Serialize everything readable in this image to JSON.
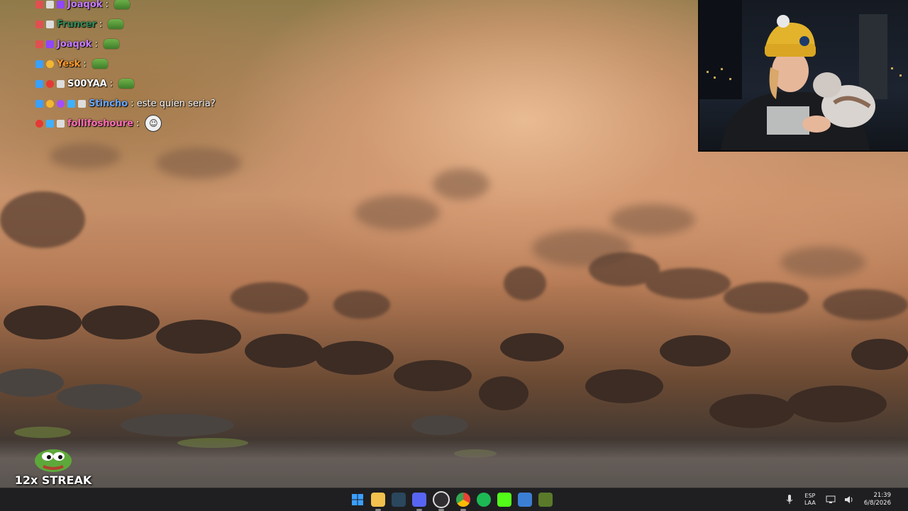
{
  "chat": {
    "messages": [
      {
        "user": "Joaqok",
        "text": ":",
        "user_color": "#c77dff",
        "emote": "pepe-emote",
        "badges": [
          "mod-icon",
          "sub-icon",
          "prime-icon"
        ]
      },
      {
        "user": "Fruncer",
        "text": ":",
        "user_color": "#2e8b57",
        "emote": "pepe-emote",
        "badges": [
          "mod-icon",
          "sub-icon"
        ]
      },
      {
        "user": "Joaqok",
        "text": ":",
        "user_color": "#c77dff",
        "emote": "pepe-emote",
        "badges": [
          "mod-icon",
          "prime-icon"
        ]
      },
      {
        "user": "Yesk",
        "text": ":",
        "user_color": "#ff9a2e",
        "emote": "pepe-emote",
        "badges": [
          "sword-icon",
          "coin-icon"
        ]
      },
      {
        "user": "S00YAA",
        "text": ":",
        "user_color": "#ffffff",
        "emote": "pepe-emote",
        "badges": [
          "sword-icon",
          "red-dot-icon",
          "sub-icon"
        ]
      },
      {
        "user": "Stincho",
        "text": ": este quien seria?",
        "user_color": "#6aa7ff",
        "emote": "",
        "badges": [
          "sword-icon",
          "coin-icon",
          "purple-icon",
          "cube-icon",
          "sub-icon"
        ]
      },
      {
        "user": "follifoshoure",
        "text": ":",
        "user_color": "#ff6fb5",
        "emote": "troll-face-emote",
        "badges": [
          "red-dot-icon",
          "cube-icon",
          "sub-icon"
        ]
      }
    ]
  },
  "streak": {
    "label": "12x STREAK"
  },
  "taskbar": {
    "apps": [
      {
        "name": "windows-start",
        "color": "#3aa0ff"
      },
      {
        "name": "file-explorer",
        "color": "#f2c14e"
      },
      {
        "name": "steam",
        "color": "#2a475e"
      },
      {
        "name": "discord",
        "color": "#5865f2"
      },
      {
        "name": "obs",
        "color": "#302e31"
      },
      {
        "name": "chrome",
        "color": "#e94235"
      },
      {
        "name": "spotify",
        "color": "#1db954"
      },
      {
        "name": "kick",
        "color": "#53fc18"
      },
      {
        "name": "ccleaner",
        "color": "#3b7fd4"
      },
      {
        "name": "game-app",
        "color": "#5a7a2a"
      }
    ],
    "language": "ESP",
    "language_sub": "LAA",
    "time": "21:39",
    "date": "6/8/2026"
  }
}
